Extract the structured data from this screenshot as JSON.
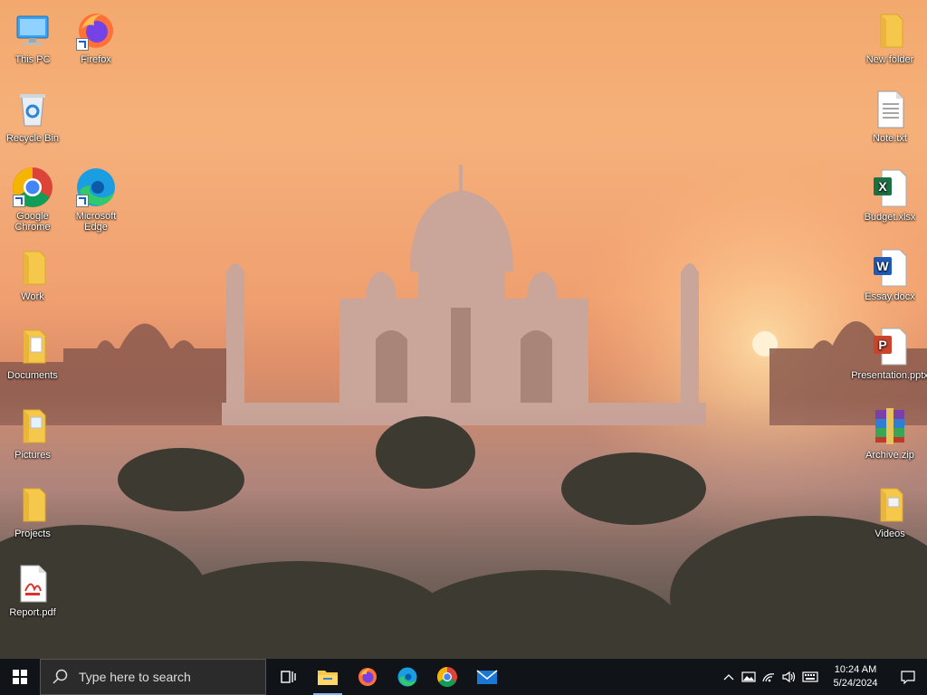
{
  "desktop": {
    "left_icons": [
      {
        "label": "This PC",
        "icon": "this-pc-icon"
      },
      {
        "label": "Firefox",
        "icon": "firefox-icon"
      },
      {
        "label": "Recycle Bin",
        "icon": "recycle-bin-icon"
      },
      {
        "label": "Google Chrome",
        "icon": "chrome-icon"
      },
      {
        "label": "Microsoft Edge",
        "icon": "edge-icon"
      },
      {
        "label": "Work",
        "icon": "folder-icon"
      },
      {
        "label": "Documents",
        "icon": "folder-icon"
      },
      {
        "label": "Pictures",
        "icon": "folder-icon"
      },
      {
        "label": "Projects",
        "icon": "folder-icon"
      },
      {
        "label": "Report.pdf",
        "icon": "pdf-file-icon"
      }
    ],
    "right_icons": [
      {
        "label": "New folder",
        "icon": "folder-icon"
      },
      {
        "label": "Note.txt",
        "icon": "text-file-icon"
      },
      {
        "label": "Budget.xlsx",
        "icon": "excel-file-icon"
      },
      {
        "label": "Essay.docx",
        "icon": "word-file-icon"
      },
      {
        "label": "Presentation.pptx",
        "icon": "powerpoint-file-icon"
      },
      {
        "label": "Archive.zip",
        "icon": "winrar-archive-icon"
      },
      {
        "label": "Videos",
        "icon": "folder-icon"
      }
    ]
  },
  "taskbar": {
    "search_placeholder": "Type here to search",
    "pinned": [
      "task-view-icon",
      "file-explorer-icon",
      "firefox-icon",
      "edge-icon",
      "chrome-icon",
      "mail-icon"
    ],
    "time": "10:24 AM",
    "date": "5/24/2024"
  },
  "colors": {
    "taskbar": "#101418",
    "folder": "#f5c84c",
    "accent": "#8ab4f8"
  }
}
